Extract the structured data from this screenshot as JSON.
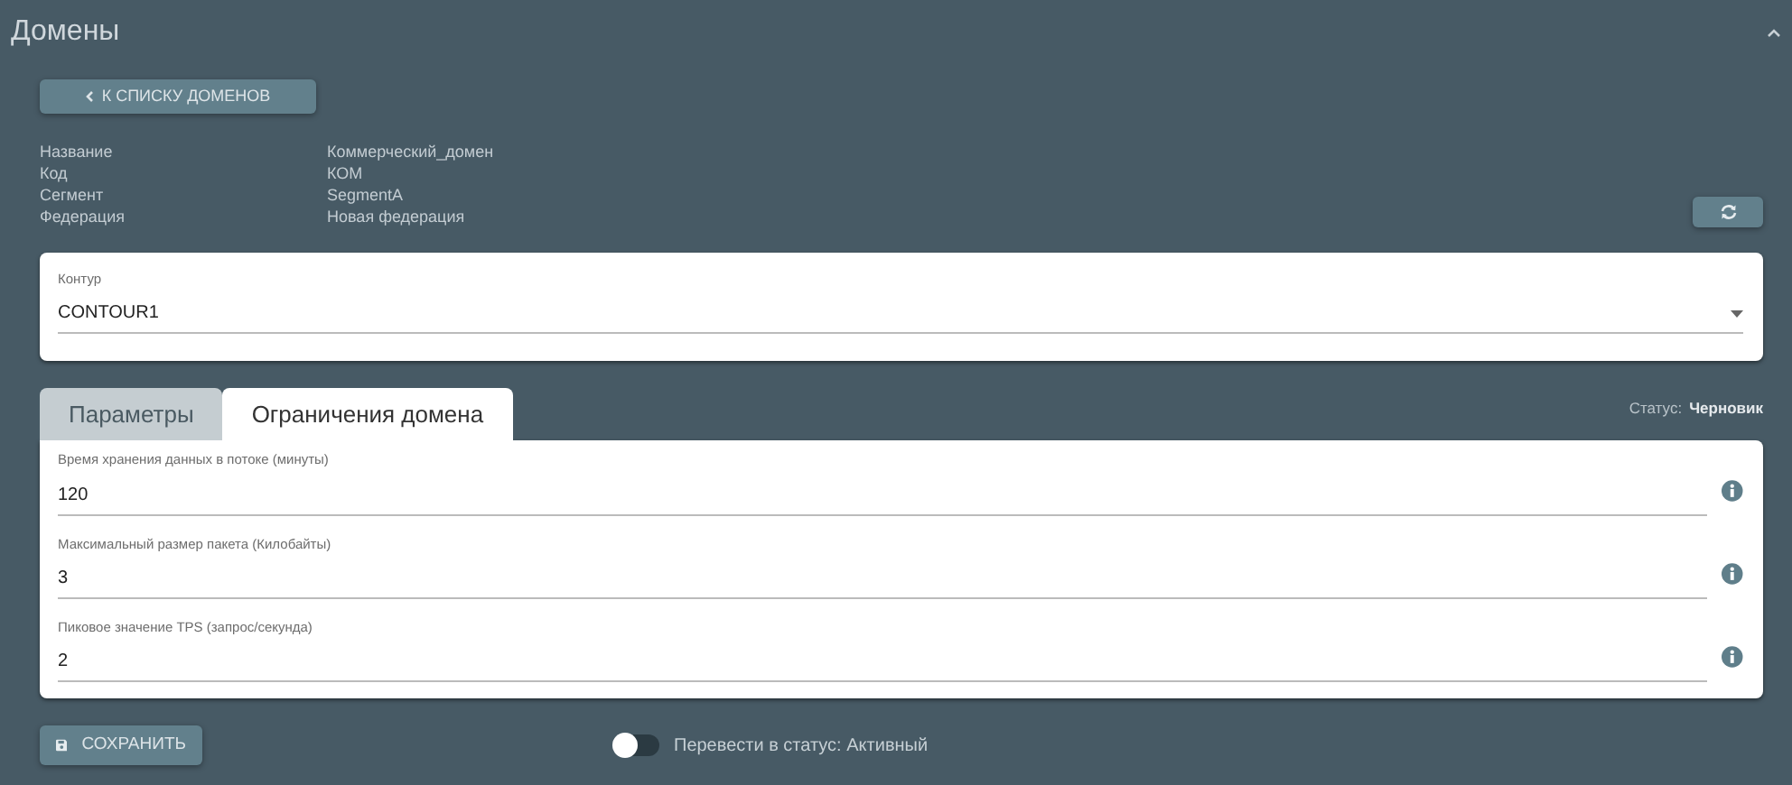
{
  "header": {
    "title": "Домены"
  },
  "back_button": {
    "label": "К СПИСКУ ДОМЕНОВ"
  },
  "info": [
    {
      "label": "Название",
      "value": "Коммерческий_домен"
    },
    {
      "label": "Код",
      "value": "КОМ"
    },
    {
      "label": "Сегмент",
      "value": "SegmentA"
    },
    {
      "label": "Федерация",
      "value": "Новая федерация"
    }
  ],
  "contour": {
    "label": "Контур",
    "value": "CONTOUR1"
  },
  "tabs": [
    {
      "label": "Параметры",
      "selected": false
    },
    {
      "label": "Ограничения домена",
      "selected": true
    }
  ],
  "status": {
    "label": "Статус:",
    "value": "Черновик"
  },
  "fields": [
    {
      "label": "Время хранения данных в потоке (минуты)",
      "value": "120"
    },
    {
      "label": "Максимальный размер пакета (Килобайты)",
      "value": "3"
    },
    {
      "label": "Пиковое значение TPS (запрос/секунда)",
      "value": "2"
    }
  ],
  "save_button": {
    "label": "СОХРАНИТЬ"
  },
  "toggle": {
    "label": "Перевести в статус: Активный",
    "on": false
  }
}
